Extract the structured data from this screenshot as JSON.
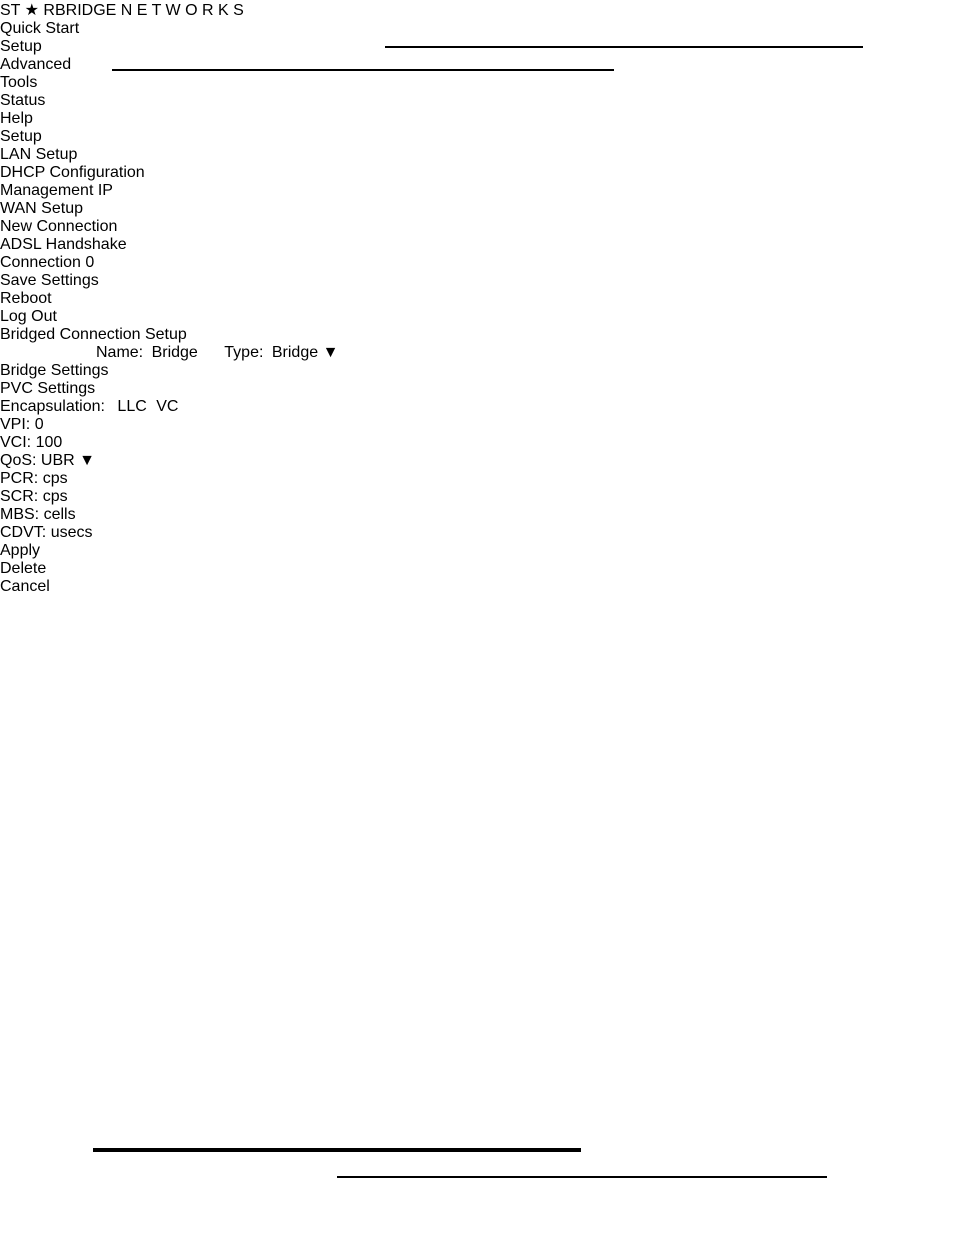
{
  "document": {
    "page_rules": [
      "header-rule-right",
      "header-rule-left",
      "footer-rule-left",
      "footer-rule-right"
    ]
  },
  "router_ui": {
    "logo": {
      "text_left": "ST",
      "star_glyph": "★",
      "text_right": "RBRIDGE",
      "subtitle": "N E T W O R K S"
    },
    "tabs": [
      {
        "label": "Quick Start",
        "active": false
      },
      {
        "label": "Setup",
        "active": true
      },
      {
        "label": "Advanced",
        "active": false
      },
      {
        "label": "Tools",
        "active": false
      },
      {
        "label": "Status",
        "active": false
      },
      {
        "label": "Help",
        "active": false
      }
    ],
    "sidebar": {
      "title": "Setup",
      "groups": [
        {
          "heading": "LAN Setup",
          "links": [
            "DHCP Configuration",
            "Management IP"
          ]
        },
        {
          "heading": "WAN Setup",
          "links": [
            "New Connection",
            "ADSL Handshake",
            "Connection 0"
          ]
        }
      ],
      "actions": [
        "Save Settings",
        "Reboot",
        "Log Out"
      ]
    },
    "form": {
      "title": "Bridged Connection Setup",
      "name_label": "Name:",
      "name_value": "Bridge",
      "type_label": "Type:",
      "type_value": "Bridge",
      "type_options": [
        "Bridge"
      ],
      "bridge_section_title": "Bridge Settings",
      "pvc_section_title": "PVC Settings",
      "encapsulation_label": "Encapsulation:",
      "encapsulation_options": [
        {
          "label": "LLC",
          "selected": true
        },
        {
          "label": "VC",
          "selected": false
        }
      ],
      "pvc_fields": [
        {
          "label": "VPI:",
          "value": "0",
          "unit": "",
          "control": "text"
        },
        {
          "label": "VCI:",
          "value": "100",
          "unit": "",
          "control": "text"
        },
        {
          "label": "QoS:",
          "value": "UBR",
          "unit": "",
          "control": "select"
        },
        {
          "label": "PCR:",
          "value": "",
          "unit": "cps",
          "control": "text"
        },
        {
          "label": "SCR:",
          "value": "",
          "unit": "cps",
          "control": "text"
        },
        {
          "label": "MBS:",
          "value": "",
          "unit": "cells",
          "control": "text"
        },
        {
          "label": "CDVT:",
          "value": "",
          "unit": "usecs",
          "control": "text"
        }
      ],
      "qos_options": [
        "UBR"
      ],
      "buttons": [
        {
          "label": "Apply"
        },
        {
          "label": "Delete"
        },
        {
          "label": "Cancel"
        }
      ]
    },
    "annotations": {
      "color": "#ee1111",
      "targets": [
        "New Connection",
        "Name field",
        "Type dropdown",
        "VPI / VCI fields"
      ]
    }
  }
}
